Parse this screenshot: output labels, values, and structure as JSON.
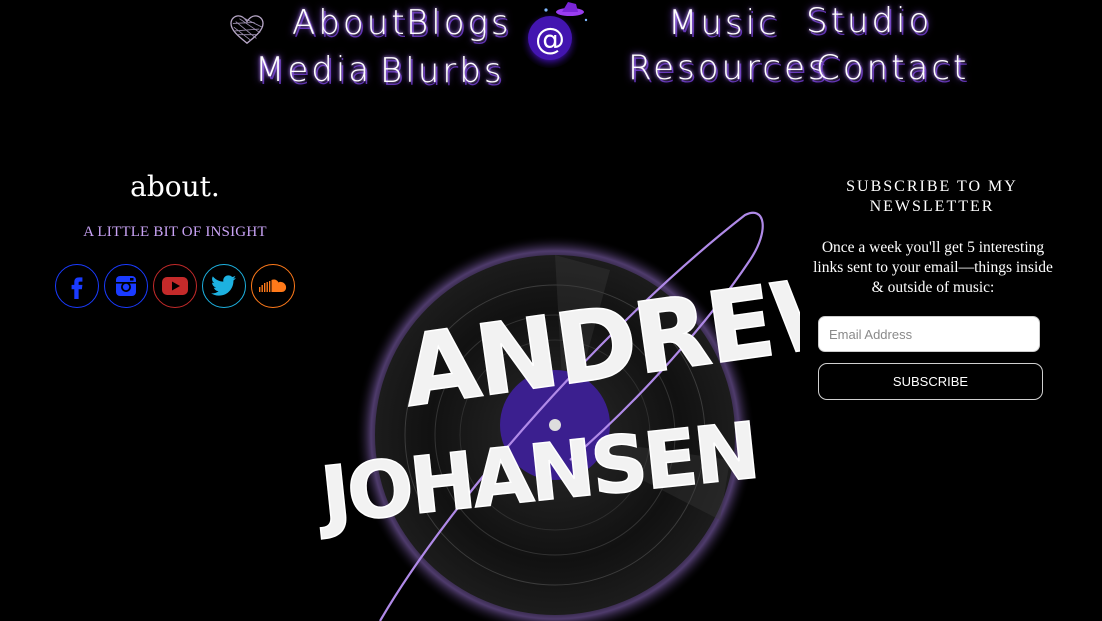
{
  "nav": {
    "about": "About",
    "blogs": "Blogs",
    "music": "Music",
    "studio": "Studio",
    "media": "Media",
    "blurbs": "Blurbs",
    "resources": "Resources",
    "contact": "Contact"
  },
  "logo": {
    "symbol": "@",
    "icon": "witch-hat-icon"
  },
  "about": {
    "title": "about.",
    "subtitle": "A LITTLE BIT OF INSIGHT"
  },
  "social": [
    {
      "icon": "facebook-icon",
      "color": "#1a3bff"
    },
    {
      "icon": "instagram-icon",
      "color": "#1a3bff"
    },
    {
      "icon": "youtube-icon",
      "color": "#c42a2a"
    },
    {
      "icon": "twitter-icon",
      "color": "#1db1e0"
    },
    {
      "icon": "soundcloud-icon",
      "color": "#ff7a1a"
    }
  ],
  "hero": {
    "line1": "ANDREW",
    "line2": "JOHANSEN"
  },
  "newsletter": {
    "title": "SUBSCRIBE TO MY NEWSLETTER",
    "description": "Once a week you'll get 5 interesting links sent to your email—things inside & outside of music:",
    "email_placeholder": "Email Address",
    "subscribe_label": "SUBSCRIBE"
  },
  "colors": {
    "background": "#000000",
    "accent_purple": "#c9a3f5",
    "glow": "#8a4cff"
  }
}
